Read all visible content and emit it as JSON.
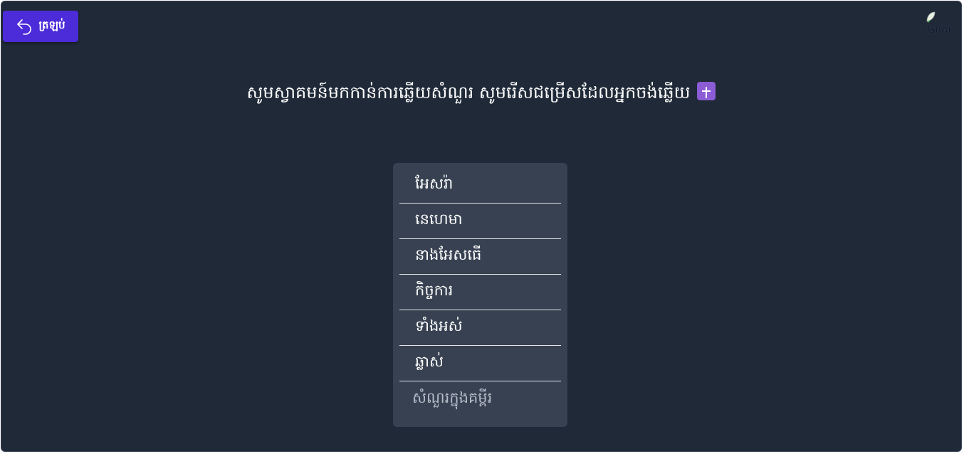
{
  "header": {
    "back_label": "ត្រឡប់",
    "logo_alt": "Tailwi"
  },
  "title": {
    "text": "សូមស្វាគមន៍មកកាន់ការឆ្លើយសំណួរ សូមរើសជម្រើសដែលអ្នកចង់ឆ្លើយ",
    "badge_icon": "cross-icon",
    "badge_color": "#8b5cd6"
  },
  "menu": {
    "items": [
      {
        "label": "អែសរ៉ា"
      },
      {
        "label": "នេហេមា"
      },
      {
        "label": "នាងអែសធើ"
      },
      {
        "label": "កិច្ចការ"
      },
      {
        "label": "ទាំងអស់"
      },
      {
        "label": "ឆ្លាស់"
      }
    ],
    "footer_label": "សំណួរក្នុងគម្ពីរ"
  },
  "colors": {
    "background": "#1f2937",
    "accent": "#4c2cd8",
    "panel": "#374151"
  }
}
